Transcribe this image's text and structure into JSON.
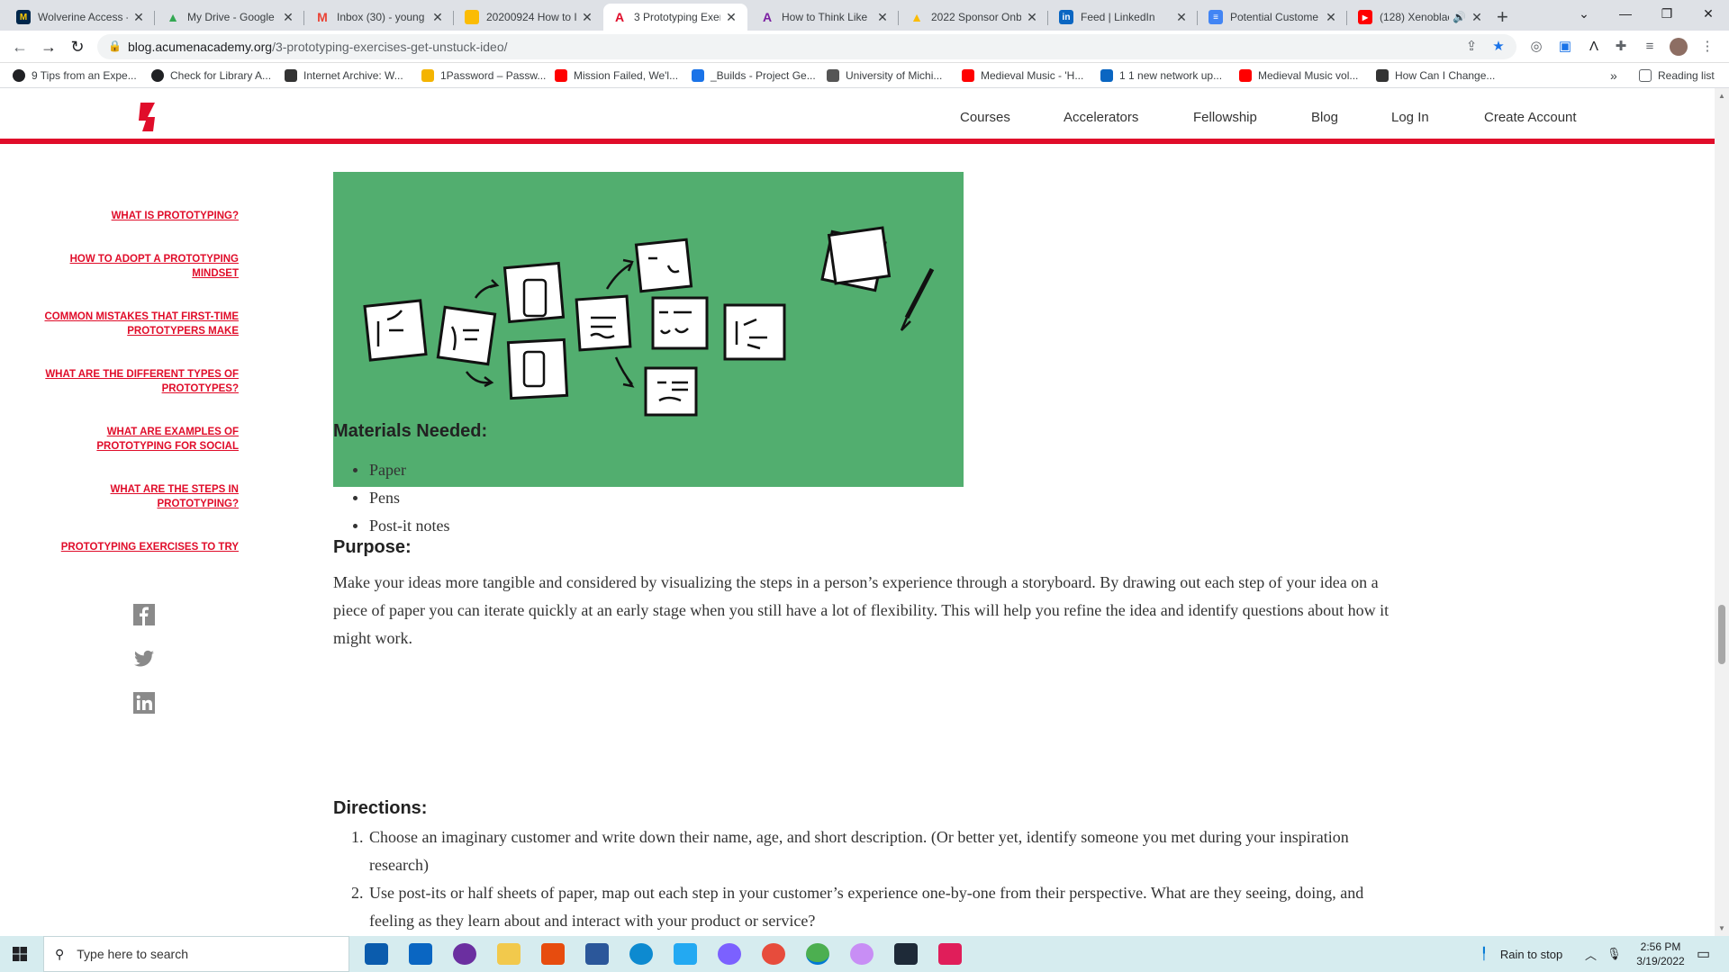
{
  "browser": {
    "tabs": [
      {
        "title": "Wolverine Access -",
        "color": "#00274c",
        "glyph": "M"
      },
      {
        "title": "My Drive - Google",
        "color": "#34a853",
        "glyph": "▲"
      },
      {
        "title": "Inbox (30) - young",
        "color": "#ea4335",
        "glyph": "M"
      },
      {
        "title": "20200924 How to I",
        "color": "#fbbc04",
        "glyph": "▭"
      },
      {
        "title": "3 Prototyping Exer",
        "color": "#e00d2a",
        "glyph": "A"
      },
      {
        "title": "How to Think Like",
        "color": "#7b1fa2",
        "glyph": "A"
      },
      {
        "title": "2022 Sponsor Onb",
        "color": "#fbbc04",
        "glyph": "▲"
      },
      {
        "title": "Feed | LinkedIn",
        "color": "#0a66c2",
        "glyph": "in"
      },
      {
        "title": "Potential Custome",
        "color": "#4285f4",
        "glyph": "≡"
      },
      {
        "title": "(128) Xenoblac",
        "color": "#ff0000",
        "glyph": "▶"
      }
    ],
    "new_tab": "+",
    "url_host": "blog.acumenacademy.org",
    "url_path": "/3-prototyping-exercises-get-unstuck-ideo/",
    "bookmarks": [
      {
        "label": "9 Tips from an Expe...",
        "color": "#202124"
      },
      {
        "label": "Check for Library A...",
        "color": "#202124"
      },
      {
        "label": "Internet Archive: W...",
        "color": "#333"
      },
      {
        "label": "1Password – Passw...",
        "color": "#f4b400"
      },
      {
        "label": "Mission Failed, We'l...",
        "color": "#ff0000"
      },
      {
        "label": "_Builds - Project Ge...",
        "color": "#1a73e8"
      },
      {
        "label": "University of Michi...",
        "color": "#555"
      },
      {
        "label": "Medieval Music - 'H...",
        "color": "#ff0000"
      },
      {
        "label": "1 1 new network up...",
        "color": "#0a66c2"
      },
      {
        "label": "Medieval Music vol...",
        "color": "#ff0000"
      },
      {
        "label": "How Can I Change...",
        "color": "#333"
      }
    ],
    "more": "»",
    "reading_list": "Reading list"
  },
  "site": {
    "nav": [
      "Courses",
      "Accelerators",
      "Fellowship",
      "Blog",
      "Log In",
      "Create Account"
    ],
    "sidebar": [
      "WHAT IS PROTOTYPING?",
      "HOW TO ADOPT A PROTOTYPING MINDSET",
      "COMMON MISTAKES THAT FIRST-TIME PROTOTYPERS MAKE",
      "WHAT ARE THE DIFFERENT TYPES OF PROTOTYPES?",
      "WHAT ARE EXAMPLES OF PROTOTYPING FOR SOCIAL",
      "WHAT ARE THE STEPS IN PROTOTYPING?",
      "PROTOTYPING EXERCISES TO TRY"
    ],
    "social": [
      "facebook-icon",
      "twitter-icon",
      "linkedin-icon"
    ],
    "accent": "#e00d2a",
    "hero_bg": "#52ae6f"
  },
  "article": {
    "materials_heading": "Materials Needed:",
    "materials": [
      "Paper",
      "Pens",
      "Post-it notes"
    ],
    "purpose_heading": "Purpose:",
    "purpose_text": "Make your ideas more tangible and considered by visualizing the steps in a person’s experience through a storyboard. By drawing out each step of your idea on a piece of paper you can iterate quickly at an early stage when you still have a lot of flexibility. This will help you refine the idea and identify questions about how it might work.",
    "directions_heading": "Directions:",
    "directions": [
      "Choose an imaginary customer and write down their name, age, and short description. (Or better yet, identify someone you met during your inspiration research)",
      "Use post-its or half sheets of paper, map out each step in your customer’s experience one-by-one from their perspective. What are they seeing, doing, and feeling as they learn about and interact with your product or service?"
    ]
  },
  "taskbar": {
    "search_placeholder": "Type here to search",
    "weather": "Rain to stop",
    "time": "2:56 PM",
    "date": "3/19/2022"
  }
}
